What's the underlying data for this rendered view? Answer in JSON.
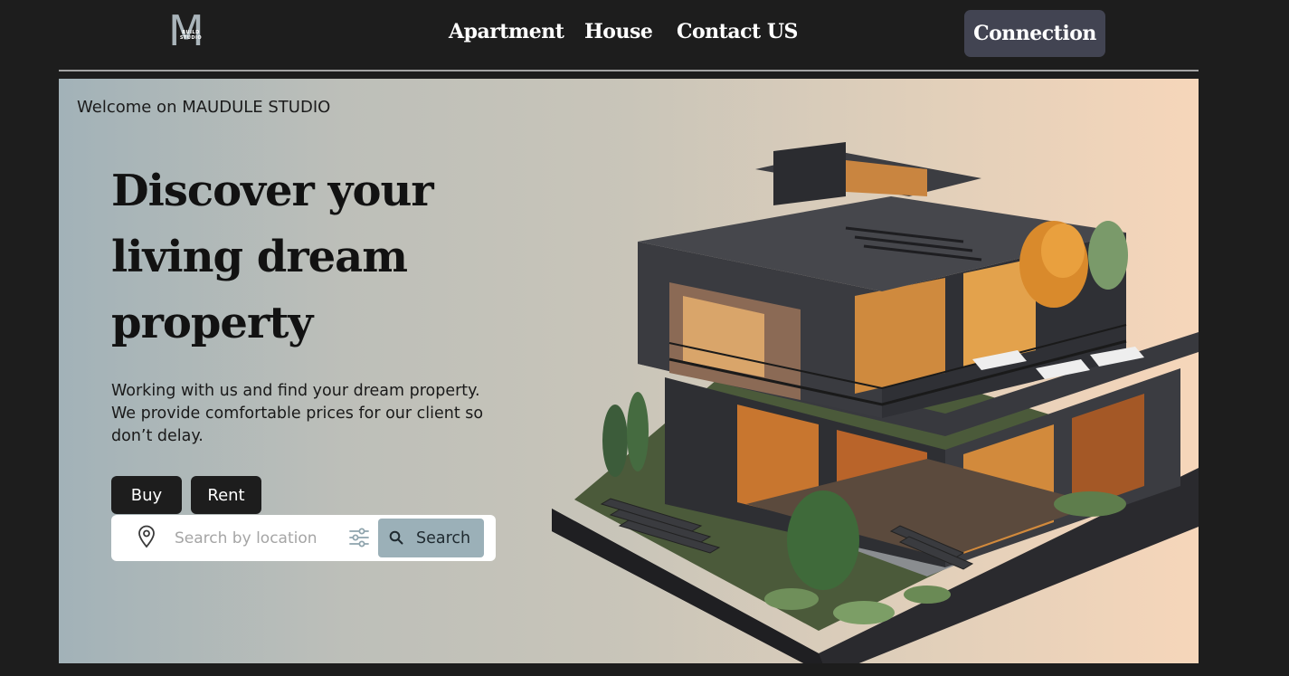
{
  "logo": {
    "letter": "M",
    "subtitle": "BUILD STUDIO"
  },
  "nav": {
    "items": [
      {
        "label": "Apartment"
      },
      {
        "label": "House"
      },
      {
        "label": "Contact US"
      }
    ],
    "connection_label": "Connection"
  },
  "hero": {
    "welcome": "Welcome on MAUDULE STUDIO",
    "headline": [
      "Discover your",
      "living dream",
      "property"
    ],
    "description": [
      "Working with us and find your dream property.",
      "We provide comfortable prices for our client so",
      "don’t delay."
    ],
    "buy_label": "Buy",
    "rent_label": "Rent",
    "search": {
      "placeholder": "Search by location",
      "button_label": "Search"
    }
  },
  "colors": {
    "page_bg": "#1d1d1d",
    "connect_btn": "#424452",
    "search_btn": "#9bb0b8",
    "gradient_left": "#a2b2b8",
    "gradient_right": "#f6d6ba"
  },
  "icons": {
    "location": "location-pin-icon",
    "filter": "sliders-icon",
    "search": "search-icon"
  }
}
